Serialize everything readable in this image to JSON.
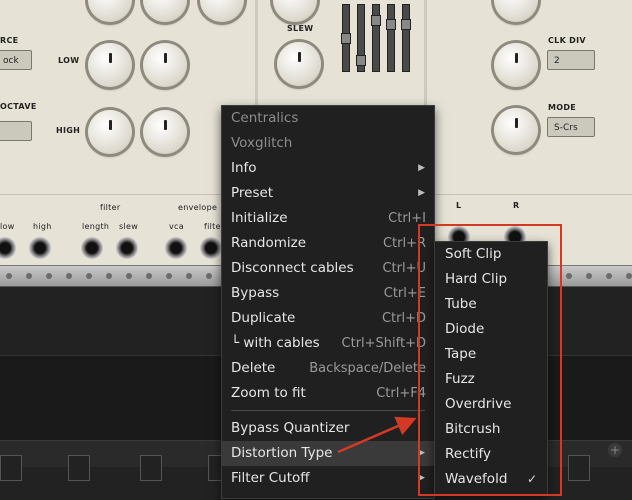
{
  "module": {
    "labels": {
      "source": "RCE",
      "low": "LOW",
      "high": "HIGH",
      "octave": "OCTAVE",
      "slew": "SLEW",
      "clk_div": "CLK DIV",
      "mode": "MODE",
      "filter": "filter",
      "envelope": "envelope",
      "low_jack": "low",
      "high_jack": "high",
      "length": "length",
      "slew_jack": "slew",
      "vca": "vca",
      "filter_jack": "filter",
      "l": "L",
      "r": "R"
    },
    "displays": {
      "source_value": "ock",
      "clk_div_value": "2",
      "mode_value": "S-Crs"
    }
  },
  "context_menu": {
    "items": [
      {
        "label": "Centralics",
        "disabled": true
      },
      {
        "label": "Voxglitch",
        "disabled": true
      },
      {
        "label": "Info",
        "submenu": true
      },
      {
        "label": "Preset",
        "submenu": true
      },
      {
        "label": "Initialize",
        "shortcut": "Ctrl+I"
      },
      {
        "label": "Randomize",
        "shortcut": "Ctrl+R"
      },
      {
        "label": "Disconnect cables",
        "shortcut": "Ctrl+U"
      },
      {
        "label": "Bypass",
        "shortcut": "Ctrl+E"
      },
      {
        "label": "Duplicate",
        "shortcut": "Ctrl+D"
      },
      {
        "label": "└ with cables",
        "shortcut": "Ctrl+Shift+D"
      },
      {
        "label": "Delete",
        "shortcut": "Backspace/Delete"
      },
      {
        "label": "Zoom to fit",
        "shortcut": "Ctrl+F4"
      },
      {
        "label": "Bypass Quantizer"
      },
      {
        "label": "Distortion Type",
        "submenu": true,
        "highlighted": true
      },
      {
        "label": "Filter Cutoff",
        "submenu": true
      }
    ]
  },
  "distortion_submenu": {
    "items": [
      "Soft Clip",
      "Hard Clip",
      "Tube",
      "Diode",
      "Tape",
      "Fuzz",
      "Overdrive",
      "Bitcrush",
      "Rectify",
      "Wavefold"
    ],
    "selected": "Wavefold",
    "check_mark": "✓"
  },
  "glyphs": {
    "submenu_arrow": "▶",
    "plus": "+"
  },
  "colors": {
    "annotation_red": "#d23a26",
    "menu_bg": "#202020",
    "panel_bg": "#e6e2d5"
  }
}
